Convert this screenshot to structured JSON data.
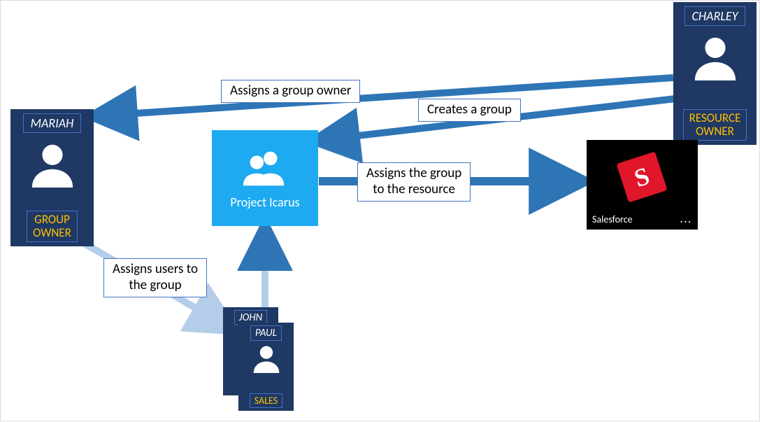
{
  "users": {
    "charley": {
      "name": "CHARLEY",
      "role": "RESOURCE\nOWNER"
    },
    "mariah": {
      "name": "MARIAH",
      "role": "GROUP\nOWNER"
    },
    "john": {
      "name": "JOHN",
      "role": "SALES"
    },
    "paul": {
      "name": "PAUL",
      "role": "SALES"
    }
  },
  "group": {
    "label": "Project Icarus"
  },
  "app": {
    "label": "Salesforce",
    "logo_letter": "S",
    "more": "..."
  },
  "labels": {
    "assigns_owner": "Assigns a group owner",
    "creates_group": "Creates a group",
    "assigns_to_res": "Assigns the group\nto the resource",
    "assigns_users": "Assigns users to\nthe group"
  },
  "colors": {
    "card_bg": "#1f3864",
    "accent_border": "#4472c4",
    "role_text": "#ffc000",
    "group_bg": "#1eaaf1",
    "arrow": "#2e75b6",
    "arrow_light": "#b4cde8",
    "red": "#e0162b"
  }
}
